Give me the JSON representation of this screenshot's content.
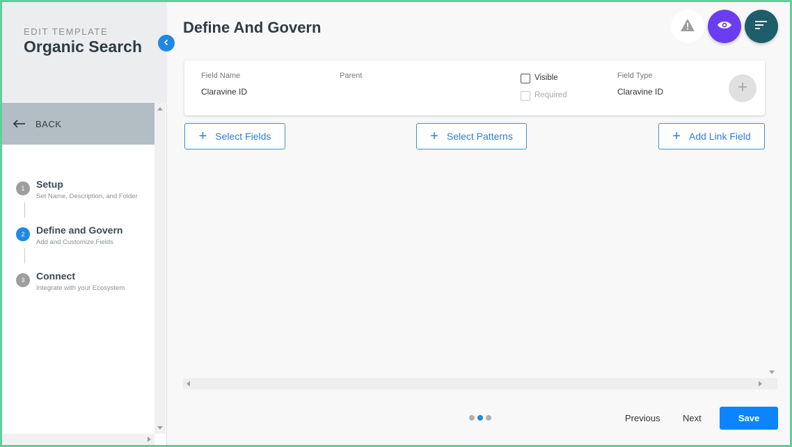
{
  "sidebar": {
    "kicker": "EDIT TEMPLATE",
    "title": "Organic Search",
    "back_label": "BACK",
    "steps": [
      {
        "num": "1",
        "title": "Setup",
        "subtitle": "Set Name, Description, and Folder",
        "active": false
      },
      {
        "num": "2",
        "title": "Define and Govern",
        "subtitle": "Add and Customize Fields",
        "active": true
      },
      {
        "num": "3",
        "title": "Connect",
        "subtitle": "Integrate with your Ecosystem",
        "active": false
      }
    ]
  },
  "main": {
    "title": "Define And Govern",
    "field_card": {
      "field_name_label": "Field Name",
      "field_name_value": "Claravine ID",
      "parent_label": "Parent",
      "visible_label": "Visible",
      "required_label": "Required",
      "field_type_label": "Field Type",
      "field_type_value": "Claravine ID"
    },
    "actions": {
      "select_fields": "Select Fields",
      "select_patterns": "Select Patterns",
      "add_link_field": "Add Link Field"
    }
  },
  "footer": {
    "previous": "Previous",
    "next": "Next",
    "save": "Save",
    "pager": {
      "total": 3,
      "active": 2
    }
  },
  "colors": {
    "accent": "#1e88e5",
    "eye_button": "#6a3ef0",
    "sort_button": "#1d5e6a",
    "save_button": "#0a84ff",
    "frame_border": "#5fcf9b"
  },
  "icons": [
    "chevron-left-icon",
    "arrow-left-icon",
    "warning-icon",
    "eye-icon",
    "sort-icon",
    "plus-icon"
  ]
}
